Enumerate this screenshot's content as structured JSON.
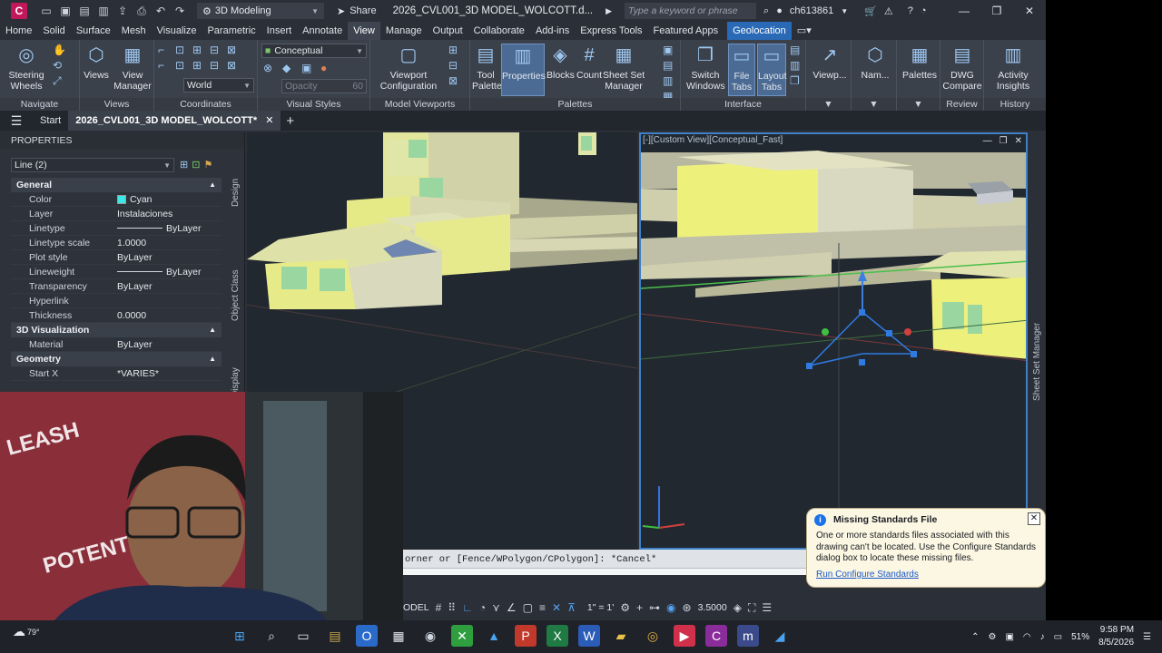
{
  "titlebar": {
    "workspace": "3D Modeling",
    "share": "Share",
    "doc_title": "2026_CVL001_3D MODEL_WOLCOTT.d...",
    "search_placeholder": "Type a keyword or phrase",
    "user": "ch613861"
  },
  "ribbon_tabs": [
    "Home",
    "Solid",
    "Surface",
    "Mesh",
    "Visualize",
    "Parametric",
    "Insert",
    "Annotate",
    "View",
    "Manage",
    "Output",
    "Collaborate",
    "Add-ins",
    "Express Tools",
    "Featured Apps"
  ],
  "ribbon_active_tab": "View",
  "geolocation_tab": "Geolocation",
  "ribbon": {
    "navigate": {
      "title": "Navigate",
      "steering": "Steering\nWheels"
    },
    "views": {
      "title": "Views",
      "views": "Views",
      "view_manager": "View\nManager"
    },
    "coordinates": {
      "title": "Coordinates",
      "world": "World"
    },
    "visual_styles": {
      "title": "Visual Styles",
      "style": "Conceptual",
      "opacity": "Opacity",
      "opacity_value": "60"
    },
    "model_viewports": {
      "title": "Model Viewports",
      "viewport_config": "Viewport\nConfiguration"
    },
    "palettes": {
      "title": "Palettes",
      "tool_palettes": "Tool\nPalettes",
      "properties": "Properties",
      "blocks": "Blocks",
      "count": "Count",
      "sheet_set": "Sheet Set\nManager"
    },
    "interface": {
      "title": "Interface",
      "switch_windows": "Switch\nWindows",
      "file_tabs": "File\nTabs",
      "layout_tabs": "Layout\nTabs",
      "viewport": "Viewp...",
      "named": "Nam...",
      "palettes": "Palettes"
    },
    "review": {
      "title": "Review",
      "dwg_compare": "DWG\nCompare"
    },
    "history": {
      "title": "History",
      "activity": "Activity\nInsights"
    }
  },
  "filetabs": {
    "start": "Start",
    "doc": "2026_CVL001_3D MODEL_WOLCOTT*"
  },
  "properties": {
    "header": "PROPERTIES",
    "selection": "Line (2)",
    "sections": {
      "general": "General",
      "viz3d": "3D Visualization",
      "geometry": "Geometry"
    },
    "rows": {
      "color": {
        "k": "Color",
        "v": "Cyan"
      },
      "layer": {
        "k": "Layer",
        "v": "Instalaciones"
      },
      "linetype": {
        "k": "Linetype",
        "v": "ByLayer"
      },
      "ltscale": {
        "k": "Linetype scale",
        "v": "1.0000"
      },
      "plotstyle": {
        "k": "Plot style",
        "v": "ByLayer"
      },
      "lineweight": {
        "k": "Lineweight",
        "v": "ByLayer"
      },
      "transparency": {
        "k": "Transparency",
        "v": "ByLayer"
      },
      "hyperlink": {
        "k": "Hyperlink",
        "v": ""
      },
      "thickness": {
        "k": "Thickness",
        "v": "0.0000"
      },
      "material": {
        "k": "Material",
        "v": "ByLayer"
      },
      "startx": {
        "k": "Start X",
        "v": "*VARIES*"
      }
    },
    "side_tabs": [
      "Design",
      "Object Class",
      "Display"
    ],
    "color_hex": "#3fe6e6"
  },
  "viewport_right": {
    "label": "[-][Custom View][Conceptual_Fast]"
  },
  "sheet_set_manager": "Sheet Set Manager",
  "command": {
    "text": "orner or [Fence/WPolygon/CPolygon]: *Cancel*"
  },
  "statusbar": {
    "model": "ODEL",
    "scale": "1\" = 1'",
    "value": "3.5000"
  },
  "notification": {
    "title": "Missing Standards File",
    "body": "One or more standards files associated with this drawing can't be located. Use the Configure Standards dialog box to locate these missing files.",
    "link": "Run Configure Standards"
  },
  "taskbar": {
    "temp": "79°",
    "battery": "51%",
    "time": "9:58 PM",
    "date": "8/5/2026"
  }
}
